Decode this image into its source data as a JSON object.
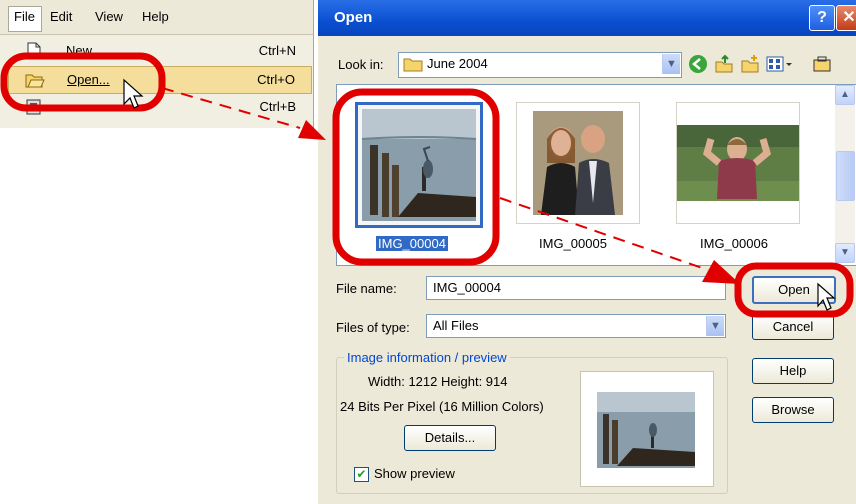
{
  "menu": {
    "bar": [
      "File",
      "Edit",
      "View",
      "Help"
    ],
    "items": [
      {
        "label": "New...",
        "shortcut": "Ctrl+N"
      },
      {
        "label": "Open...",
        "shortcut": "Ctrl+O"
      },
      {
        "label": "",
        "shortcut": "Ctrl+B"
      }
    ]
  },
  "dialog": {
    "title": "Open",
    "look_in_label": "Look in:",
    "look_in_value": "June 2004",
    "files": [
      {
        "name": "IMG_00004",
        "selected": true
      },
      {
        "name": "IMG_00005",
        "selected": false
      },
      {
        "name": "IMG_00006",
        "selected": false
      }
    ],
    "file_name_label": "File name:",
    "file_name_value": "IMG_00004",
    "files_of_type_label": "Files of type:",
    "files_of_type_value": "All Files",
    "buttons": {
      "open": "Open",
      "cancel": "Cancel",
      "help": "Help",
      "browse": "Browse",
      "details": "Details..."
    },
    "info": {
      "title": "Image information / preview",
      "dimensions": "Width: 1212 Height: 914",
      "color_depth": "24 Bits Per Pixel (16 Million Colors)"
    },
    "show_preview_label": "Show preview",
    "show_preview_checked": true
  },
  "colors": {
    "annotation": "#e00000",
    "selection": "#316ac5",
    "titlebar": "#0a4fd0"
  }
}
